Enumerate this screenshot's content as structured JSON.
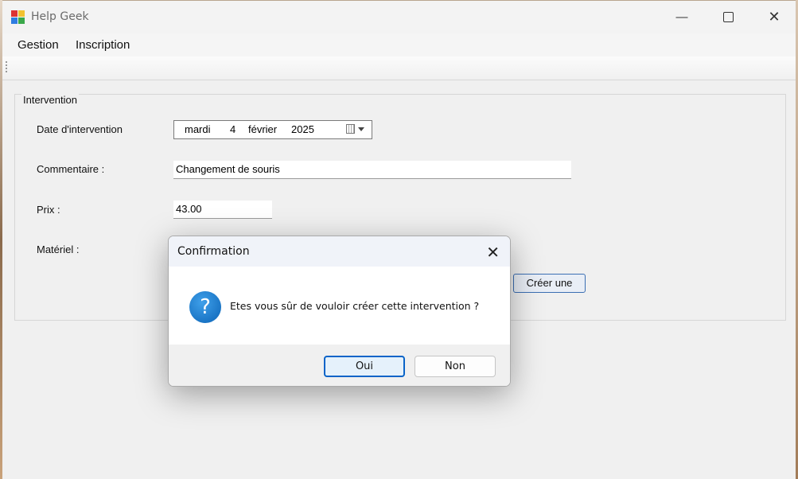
{
  "window": {
    "title": "Help Geek",
    "controls": {
      "minimize": "—",
      "close": "✕"
    }
  },
  "menu": {
    "items": [
      "Gestion",
      "Inscription"
    ]
  },
  "group": {
    "legend": "Intervention",
    "date_label": "Date d'intervention",
    "date": {
      "weekday": "mardi",
      "day": "4",
      "month": "février",
      "year": "2025"
    },
    "comment_label": "Commentaire :",
    "comment_value": "Changement de souris",
    "price_label": "Prix :",
    "price_value": "43.00",
    "material_label": "Matériel :",
    "create_button": "Créer une"
  },
  "dialog": {
    "title": "Confirmation",
    "close_glyph": "✕",
    "icon_glyph": "?",
    "message": "Etes vous sûr de vouloir créer cette intervention ?",
    "yes": "Oui",
    "no": "Non"
  },
  "colors": {
    "accent": "#0a64c8",
    "question_icon": "#1a78d2"
  }
}
